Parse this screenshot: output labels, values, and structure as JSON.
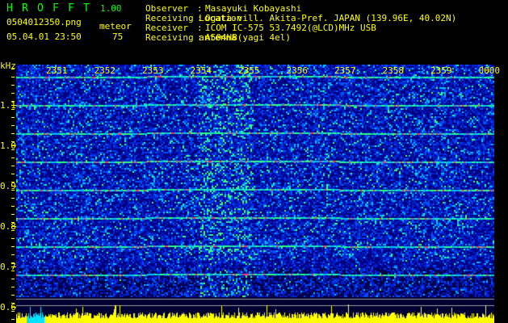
{
  "header": {
    "app_letters": [
      "H",
      "R",
      "O",
      "F",
      "F",
      "T"
    ],
    "version": "1.00",
    "filename": "0504012350.png",
    "datetime": "05.04.01 23:50",
    "meteor_label": "meteor",
    "meteor_count": "75",
    "info": [
      {
        "label": "Observer",
        "sep": ":",
        "value": "Masayuki Kobayashi"
      },
      {
        "label": "Receiving Location",
        "sep": ":",
        "value": "Ogata-vill. Akita-Pref. JAPAN (139.96E, 40.02N)"
      },
      {
        "label": "Receiver",
        "sep": ":",
        "value": "ICOM IC-575 53.7492(@LCD)MHz USB"
      },
      {
        "label": "Receiving antenna",
        "sep": ":",
        "value": "A504HB(yagi 4el)"
      }
    ]
  },
  "colors": {
    "text": "#ffff00",
    "title": "#00ff00",
    "background": "#000000",
    "noise_floor": "#0000c8",
    "signal_mid": "#00ff80",
    "signal_high": "#ff2060"
  },
  "chart_data": {
    "type": "heatmap",
    "ylabel": "kHz",
    "y_ticks": [
      "1.1",
      "1.0",
      "0.9",
      "0.8",
      "0.7",
      "0.6"
    ],
    "y_tick_values": [
      1.1,
      1.0,
      0.9,
      0.8,
      0.7,
      0.6
    ],
    "ylim": [
      0.56,
      1.2
    ],
    "x_ticks": [
      "2351",
      "2352",
      "2353",
      "2354",
      "2355",
      "2356",
      "2357",
      "2358",
      "2359",
      "0000"
    ],
    "xlim_minutes": [
      "23:50",
      "00:00"
    ],
    "carrier_lines_khz": [
      1.17,
      1.1,
      1.03,
      0.96,
      0.89,
      0.82,
      0.75,
      0.68
    ],
    "high_activity_band": [
      "2353.5",
      "2354.6"
    ],
    "grid": false
  }
}
